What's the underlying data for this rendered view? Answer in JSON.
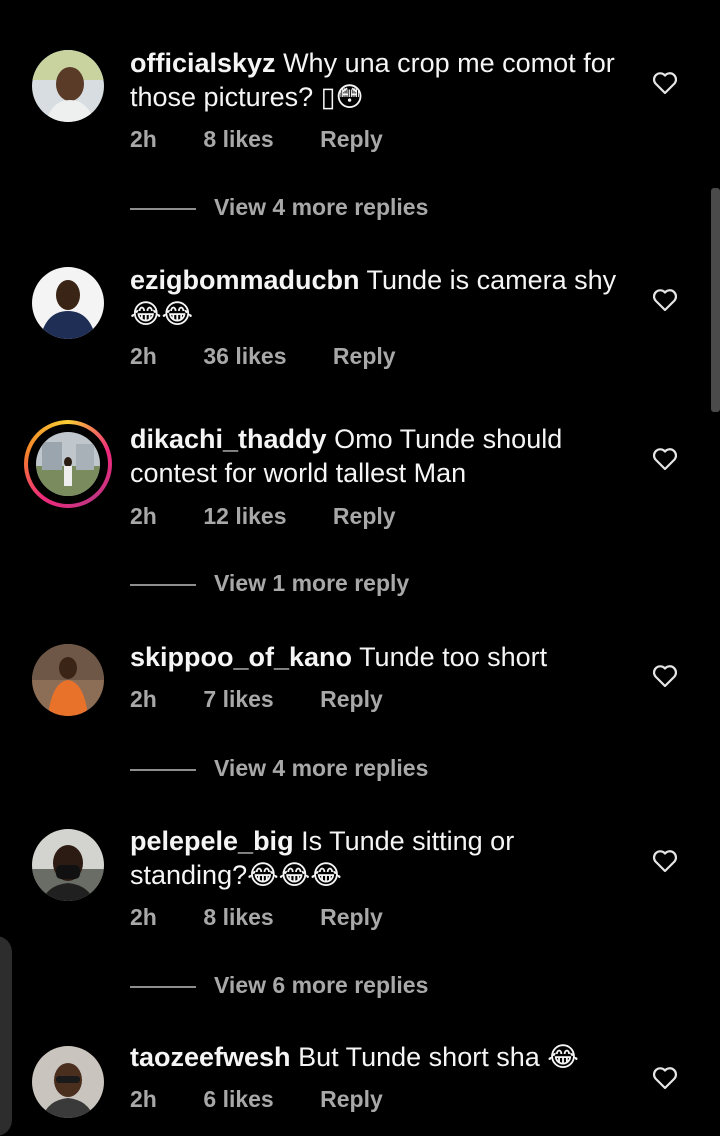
{
  "comments": [
    {
      "username": "officialskyz",
      "text": "Why una crop me comot for those pictures? ▯😳",
      "time": "2h",
      "likes": "8 likes",
      "reply": "Reply",
      "view_more": "View 4 more replies",
      "story": false
    },
    {
      "username": "ezigbommaducbn",
      "text": "Tunde is camera shy 😂😂",
      "time": "2h",
      "likes": "36 likes",
      "reply": "Reply",
      "view_more": "",
      "story": false
    },
    {
      "username": "dikachi_thaddy",
      "text": "Omo Tunde should contest for world tallest Man",
      "time": "2h",
      "likes": "12 likes",
      "reply": "Reply",
      "view_more": "View 1 more reply",
      "story": true
    },
    {
      "username": "skippoo_of_kano",
      "text": "Tunde too short",
      "time": "2h",
      "likes": "7 likes",
      "reply": "Reply",
      "view_more": "View 4 more replies",
      "story": false
    },
    {
      "username": "pelepele_big",
      "text": "Is Tunde sitting or standing?😂😂😂",
      "time": "2h",
      "likes": "8 likes",
      "reply": "Reply",
      "view_more": "View 6 more replies",
      "story": false
    },
    {
      "username": "taozeefwesh",
      "text": "But Tunde short sha 😂",
      "time": "2h",
      "likes": "6 likes",
      "reply": "Reply",
      "view_more": "",
      "story": false
    }
  ],
  "icons": {
    "heart": "heart-outline-icon"
  },
  "colors": {
    "background": "#000000",
    "text": "#f5f5f5",
    "secondary": "#a8a8a8"
  }
}
